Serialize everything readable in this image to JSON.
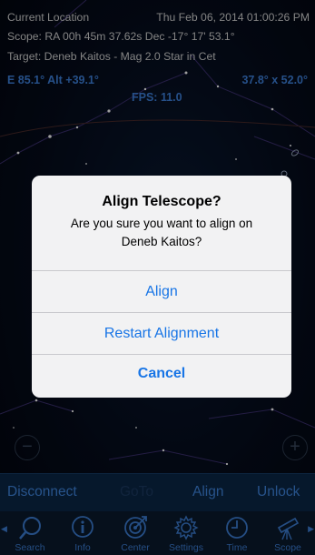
{
  "status": {
    "location": "Current Location",
    "datetime": "Thu Feb 06, 2014  01:00:26 PM",
    "scope_position": "Scope: RA 00h 45m 37.62s    Dec -17° 17' 53.1°",
    "target": "Target: Deneb Kaitos - Mag 2.0 Star in Cet"
  },
  "hud": {
    "alt_az": "E 85.1° Alt +39.1°",
    "fov": "37.8° x 52.0°",
    "fps": "FPS: 11.0"
  },
  "zoom": {
    "out": "−",
    "in": "+"
  },
  "dialog": {
    "title": "Align Telescope?",
    "message": "Are you sure you want to align on Deneb Kaitos?",
    "buttons": {
      "align": "Align",
      "restart": "Restart Alignment",
      "cancel": "Cancel"
    }
  },
  "scope_bar": {
    "disconnect": "Disconnect",
    "goto": "GoTo",
    "align": "Align",
    "unlock": "Unlock"
  },
  "tabs": [
    {
      "label": "Search",
      "icon": "magnifier-icon"
    },
    {
      "label": "Info",
      "icon": "info-icon"
    },
    {
      "label": "Center",
      "icon": "target-icon"
    },
    {
      "label": "Settings",
      "icon": "gear-icon"
    },
    {
      "label": "Time",
      "icon": "clock-icon"
    },
    {
      "label": "Scope",
      "icon": "telescope-icon"
    }
  ],
  "colors": {
    "accent": "#3f86e0",
    "dialog_button": "#1875e6",
    "disabled": "#1c3b63",
    "scope_bar_bg": "#0b2747"
  }
}
